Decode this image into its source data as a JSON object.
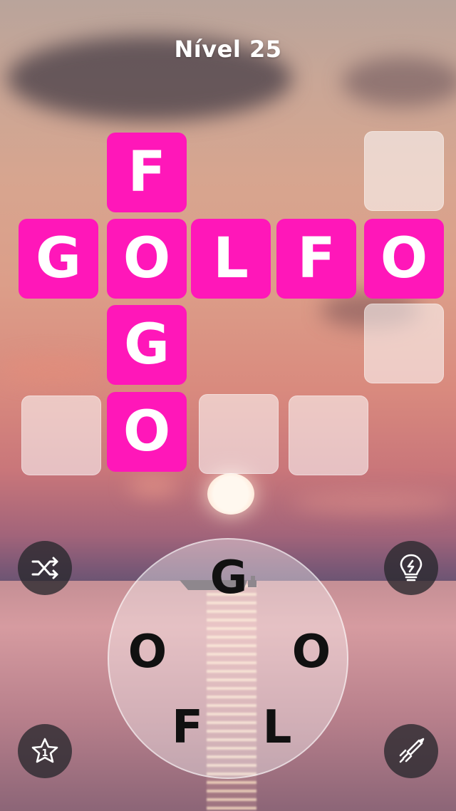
{
  "level": {
    "title": "Nível 25"
  },
  "grid": {
    "tiles": [
      "F",
      "G",
      "O",
      "L",
      "F",
      "O",
      "G",
      "O"
    ]
  },
  "wheel": {
    "letters": [
      "G",
      "O",
      "O",
      "F",
      "L"
    ]
  },
  "buttons": {
    "shuffle_icon": "shuffle-icon",
    "hint_icon": "lightbulb-icon",
    "star_icon": "star-icon",
    "star_count": "1",
    "rocket_icon": "rocket-icon"
  },
  "colors": {
    "filled_tile": "#ff17b9",
    "empty_tile": "rgba(255,255,255,0.55)"
  }
}
